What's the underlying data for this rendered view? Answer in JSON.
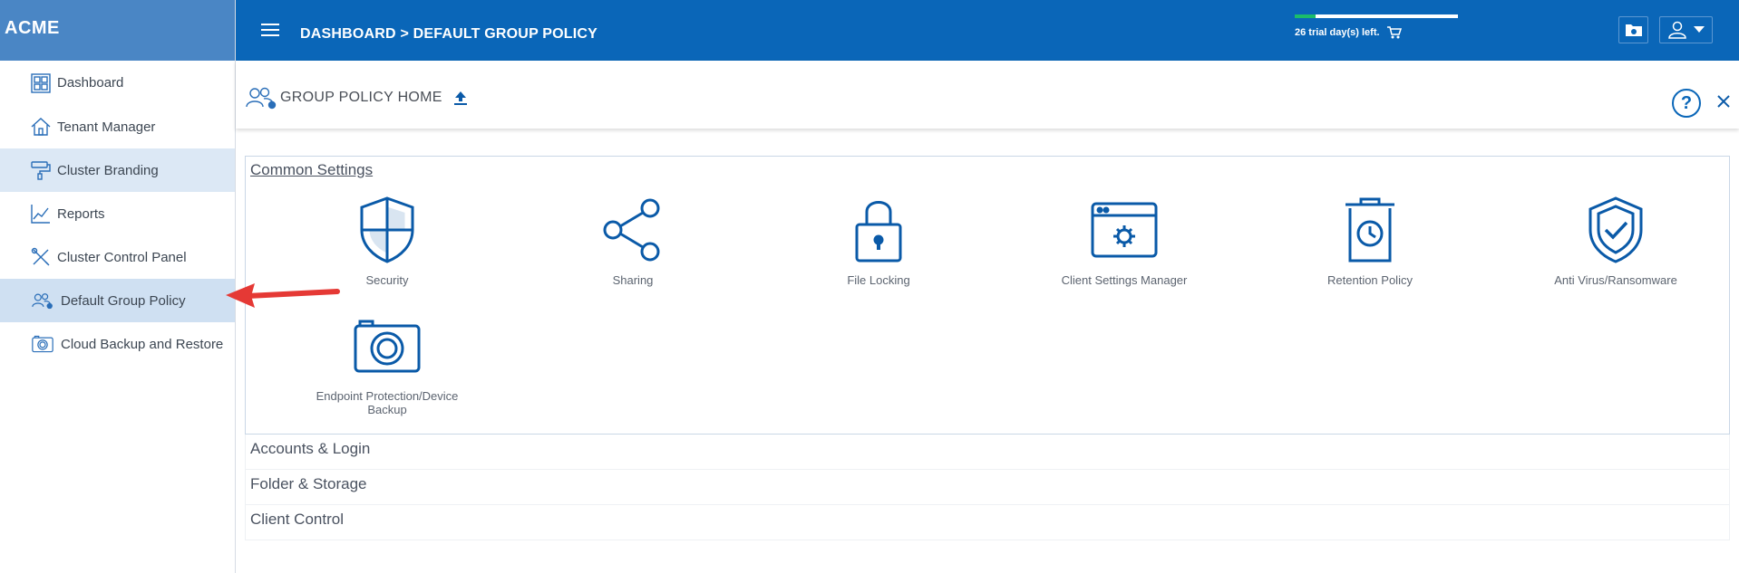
{
  "brand": "ACME",
  "sidebar": {
    "items": [
      {
        "label": "Dashboard",
        "icon": "dashboard-grid-icon"
      },
      {
        "label": "Tenant Manager",
        "icon": "house-icon"
      },
      {
        "label": "Cluster Branding",
        "icon": "paint-roller-icon"
      },
      {
        "label": "Reports",
        "icon": "line-chart-icon"
      },
      {
        "label": "Cluster Control Panel",
        "icon": "tools-icon"
      },
      {
        "label": "Default Group Policy",
        "icon": "users-gear-icon"
      },
      {
        "label": "Cloud Backup and Restore",
        "icon": "camera-icon"
      }
    ]
  },
  "header": {
    "breadcrumb": "DASHBOARD > DEFAULT GROUP POLICY",
    "trial_text": "26 trial day(s) left.",
    "trial_progress": 0.13
  },
  "page": {
    "title": "GROUP POLICY HOME",
    "help": "?"
  },
  "common_settings": {
    "title": "Common Settings",
    "tiles": [
      {
        "label": "Security",
        "icon": "shield-cross-icon"
      },
      {
        "label": "Sharing",
        "icon": "share-icon"
      },
      {
        "label": "File Locking",
        "icon": "lock-icon"
      },
      {
        "label": "Client Settings Manager",
        "icon": "browser-gear-icon"
      },
      {
        "label": "Retention Policy",
        "icon": "trash-clock-icon"
      },
      {
        "label": "Anti Virus/Ransomware",
        "icon": "shield-check-icon"
      },
      {
        "label": "Endpoint Protection/Device Backup",
        "icon": "camera-icon"
      }
    ]
  },
  "sections": [
    {
      "label": "Accounts & Login"
    },
    {
      "label": "Folder & Storage"
    },
    {
      "label": "Client Control"
    }
  ],
  "colors": {
    "brand": "#4a86c5",
    "header": "#0a66b8",
    "icon_blue": "#0a5aa8",
    "arrow": "#e53935",
    "trial_progress": "#1bbd6a"
  }
}
